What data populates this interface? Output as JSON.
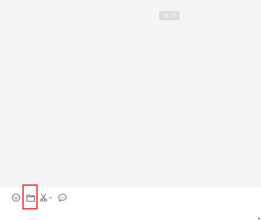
{
  "chat": {
    "timestamp": "18:22"
  },
  "toolbar": {
    "tools": [
      {
        "name": "emoji",
        "icon": "emoji-icon"
      },
      {
        "name": "send-file",
        "icon": "folder-icon"
      },
      {
        "name": "screenshot",
        "icon": "scissors-icon"
      },
      {
        "name": "chat-history",
        "icon": "chat-bubble-icon"
      }
    ],
    "highlighted_tool": "send-file"
  },
  "colors": {
    "message_area_bg": "#f5f5f5",
    "timestamp_bg": "#dadada",
    "icon_stroke": "#555555",
    "highlight": "#e5302e"
  }
}
